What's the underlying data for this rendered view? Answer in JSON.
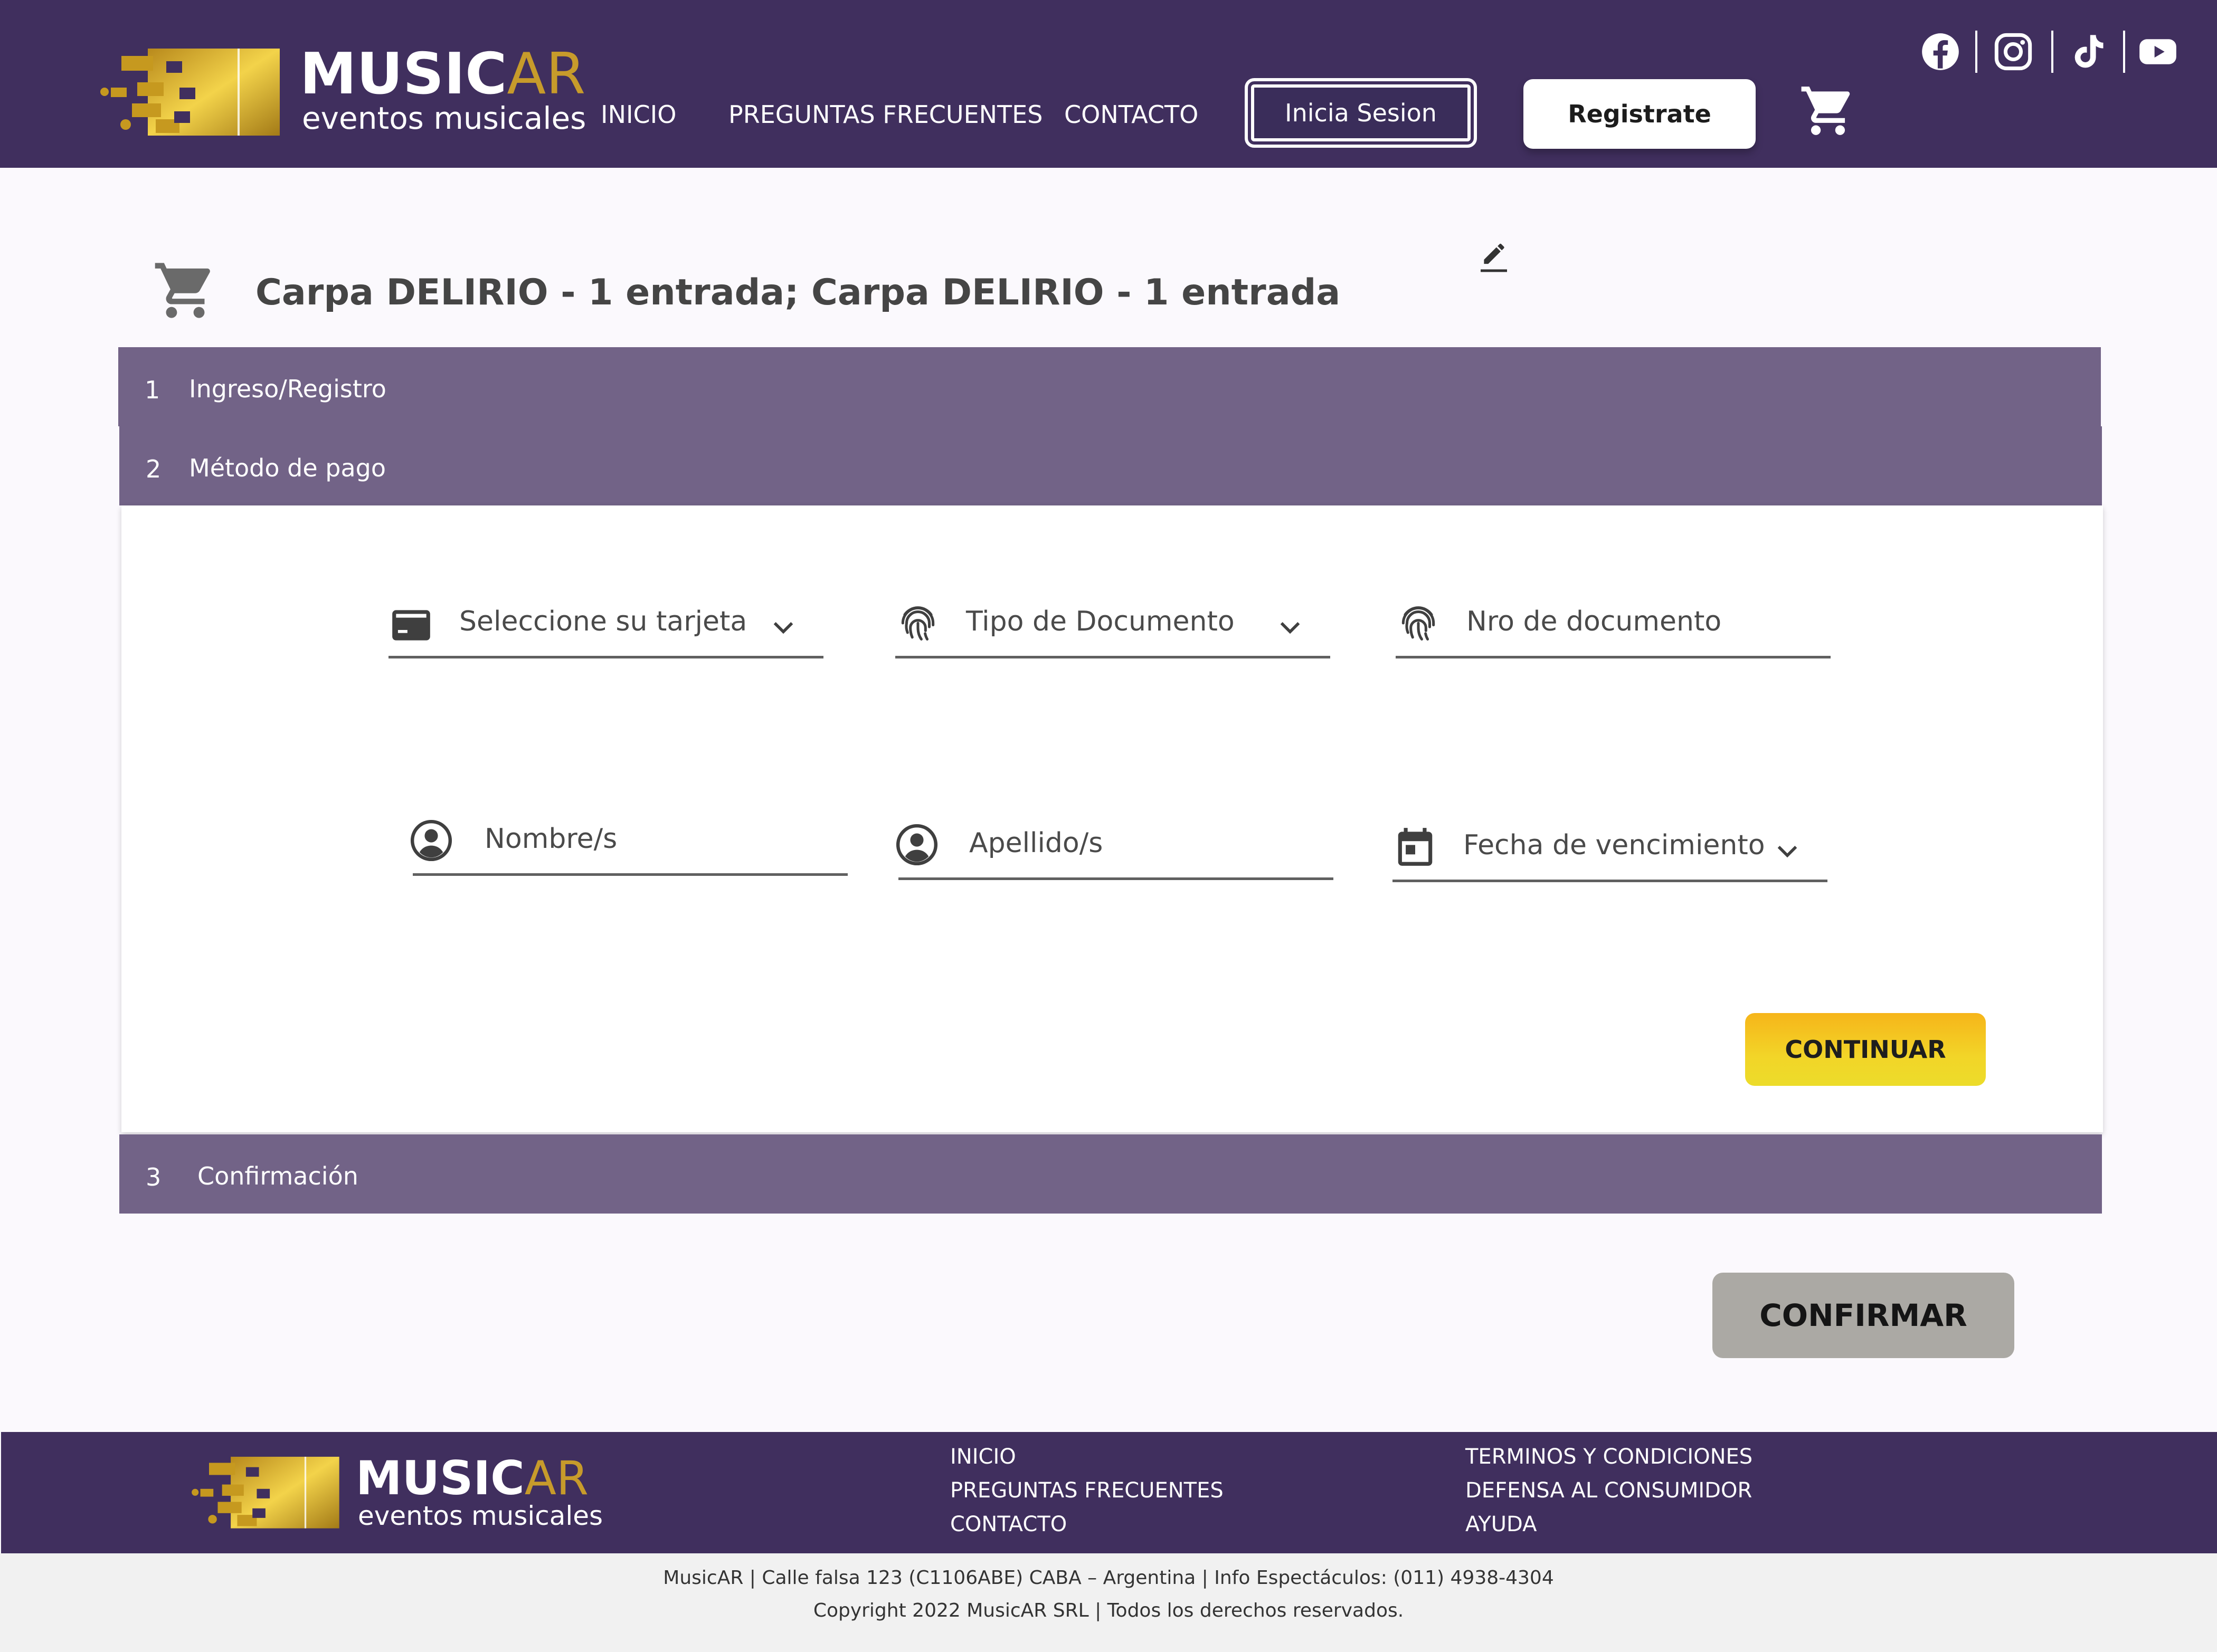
{
  "brand": {
    "name_main": "MUSIC",
    "name_accent": "AR",
    "tagline": "eventos musicales"
  },
  "nav": {
    "items": [
      "INICIO",
      "PREGUNTAS FRECUENTES",
      "CONTACTO"
    ],
    "login_label": "Inicia Sesion",
    "register_label": "Registrate"
  },
  "social": [
    "facebook-icon",
    "instagram-icon",
    "tiktok-icon",
    "youtube-icon"
  ],
  "order": {
    "title": "Carpa DELIRIO - 1 entrada; Carpa DELIRIO - 1 entrada"
  },
  "steps": [
    {
      "number": "1",
      "label": "Ingreso/Registro"
    },
    {
      "number": "2",
      "label": "Método de pago"
    },
    {
      "number": "3",
      "label": "Confirmación"
    }
  ],
  "form": {
    "card_select": "Seleccione su tarjeta",
    "doc_type": "Tipo de Documento",
    "doc_number": "Nro de documento",
    "first_name": "Nombre/s",
    "last_name": "Apellido/s",
    "expiry": "Fecha de vencimiento"
  },
  "buttons": {
    "continue": "CONTINUAR",
    "confirm": "CONFIRMAR"
  },
  "footer": {
    "links_left": [
      "INICIO",
      "PREGUNTAS FRECUENTES",
      "CONTACTO"
    ],
    "links_right": [
      "TERMINOS Y CONDICIONES",
      "DEFENSA AL CONSUMIDOR",
      "AYUDA"
    ],
    "address": "MusicAR | Calle falsa 123 (C1106ABE) CABA – Argentina | Info Espectáculos: (011) 4938-4304",
    "copyright": "Copyright 2022 MusicAR SRL | Todos los derechos reservados."
  },
  "colors": {
    "header_bg": "#402f5e",
    "step_bg": "#726387",
    "accent_gold": "#c79b2b",
    "continue_yellow": "#f2d528",
    "confirm_gray": "#aba9a4"
  }
}
